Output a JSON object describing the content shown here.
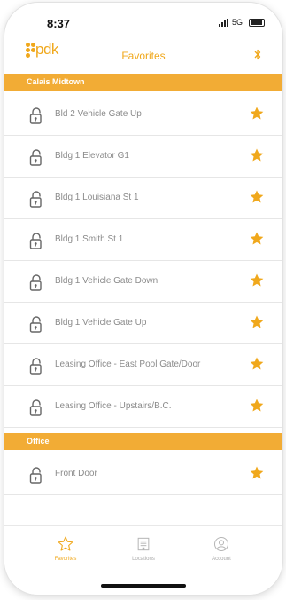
{
  "status": {
    "time": "8:37",
    "network": "5G"
  },
  "header": {
    "logo_text": "pdk",
    "title": "Favorites"
  },
  "sections": [
    {
      "title": "Calais Midtown",
      "items": [
        {
          "label": "Bld 2 Vehicle Gate Up"
        },
        {
          "label": "Bldg 1 Elevator G1"
        },
        {
          "label": "Bldg 1 Louisiana St 1"
        },
        {
          "label": "Bldg 1 Smith St 1"
        },
        {
          "label": "Bldg 1 Vehicle Gate Down"
        },
        {
          "label": "Bldg 1 Vehicle Gate Up"
        },
        {
          "label": "Leasing Office - East Pool Gate/Door"
        },
        {
          "label": "Leasing Office - Upstairs/B.C."
        }
      ]
    },
    {
      "title": "Office",
      "items": [
        {
          "label": "Front Door"
        }
      ]
    }
  ],
  "tabs": [
    {
      "label": "Favorites",
      "icon": "star-outline-icon",
      "active": true
    },
    {
      "label": "Locations",
      "icon": "building-icon",
      "active": false
    },
    {
      "label": "Account",
      "icon": "account-circle-icon",
      "active": false
    }
  ],
  "colors": {
    "accent": "#f2ac35",
    "star": "#f0a81c",
    "text_muted": "#8b8b8b"
  }
}
